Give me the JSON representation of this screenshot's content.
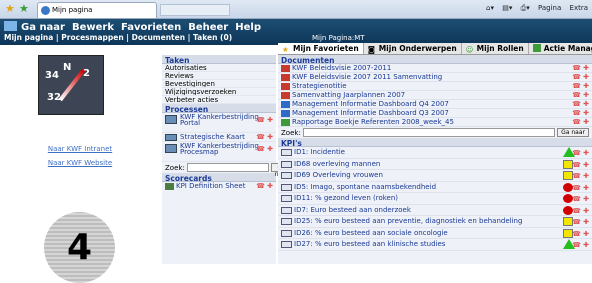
{
  "browser": {
    "tab_title": "Mijn pagina",
    "tools": [
      "Pagina",
      "Extra"
    ]
  },
  "app": {
    "menu": [
      "Ga naar",
      "Bewerk",
      "Favorieten",
      "Beheer",
      "Help"
    ],
    "subnav": "Mijn pagina | Procesmappen | Documenten | Taken (0)",
    "page_label": "Mijn Pagina:MT",
    "tabs": [
      "Mijn Favorieten",
      "Mijn Onderwerpen",
      "Mijn Rollen",
      "Actie Manageme"
    ]
  },
  "sidebar": {
    "compass_numbers": [
      "34",
      "N",
      "2",
      "32"
    ],
    "link_intranet": "Naar KWF Intranet",
    "link_website": "Naar KWF Website",
    "circle_number": "4"
  },
  "taken": {
    "header": "Taken",
    "items": [
      "Autorisaties",
      "Reviews",
      "Bevestigingen",
      "Wijzigingsverzoeken",
      "Verbeter acties"
    ]
  },
  "processen": {
    "header": "Processen",
    "items": [
      {
        "label": "KWF Kankerbestrijding Portal"
      },
      {
        "label": "Strategische Kaart"
      },
      {
        "label": "KWF Kankerbestrijding Procesmap"
      }
    ],
    "search_label": "Zoek:",
    "search_button": "Ga naar"
  },
  "scorecards": {
    "header": "Scorecards",
    "items": [
      "KPI Definition Sheet"
    ]
  },
  "documenten": {
    "header": "Documenten",
    "items": [
      {
        "label": "KWF Beleidsvisie 2007-2011",
        "icon": "pdf"
      },
      {
        "label": "KWF Beleidsvisie 2007 2011 Samenvatting",
        "icon": "pdf"
      },
      {
        "label": "Strategienotitie",
        "icon": "pdf"
      },
      {
        "label": "Samenvatting Jaarplannen 2007",
        "icon": "pdf"
      },
      {
        "label": "Management Informatie Dashboard Q4 2007",
        "icon": "doc"
      },
      {
        "label": "Management Informatie Dashboard Q3 2007",
        "icon": "doc"
      },
      {
        "label": "Rapportage Boekje Referenten 2008_week_45",
        "icon": "xls"
      }
    ],
    "search_label": "Zoek:",
    "search_button": "Ga naar"
  },
  "kpis": {
    "header": "KPI's",
    "items": [
      {
        "label": "ID1: Incidentie",
        "status": "green-triangle"
      },
      {
        "label": "ID68 overleving mannen",
        "status": "yellow-square"
      },
      {
        "label": "ID69 Overleving vrouwen",
        "status": "yellow-square"
      },
      {
        "label": "ID5: Imago, spontane naamsbekendheid",
        "status": "red-circle"
      },
      {
        "label": "ID11: % gezond leven (roken)",
        "status": "red-circle"
      },
      {
        "label": "ID7: Euro besteed aan onderzoek",
        "status": "red-circle"
      },
      {
        "label": "ID25: % euro besteed aan preventie, diagnostiek en behandeling",
        "status": "yellow-square"
      },
      {
        "label": "ID26: % euro besteed aan sociale oncologie",
        "status": "yellow-square"
      },
      {
        "label": "ID27: % euro besteed aan klinische studies",
        "status": "green-triangle"
      }
    ]
  },
  "colors": {
    "app_bar": "#0d3558",
    "link": "#3f6fc4",
    "green": "#22c01e",
    "yellow": "#f2e600",
    "red": "#d40000"
  }
}
